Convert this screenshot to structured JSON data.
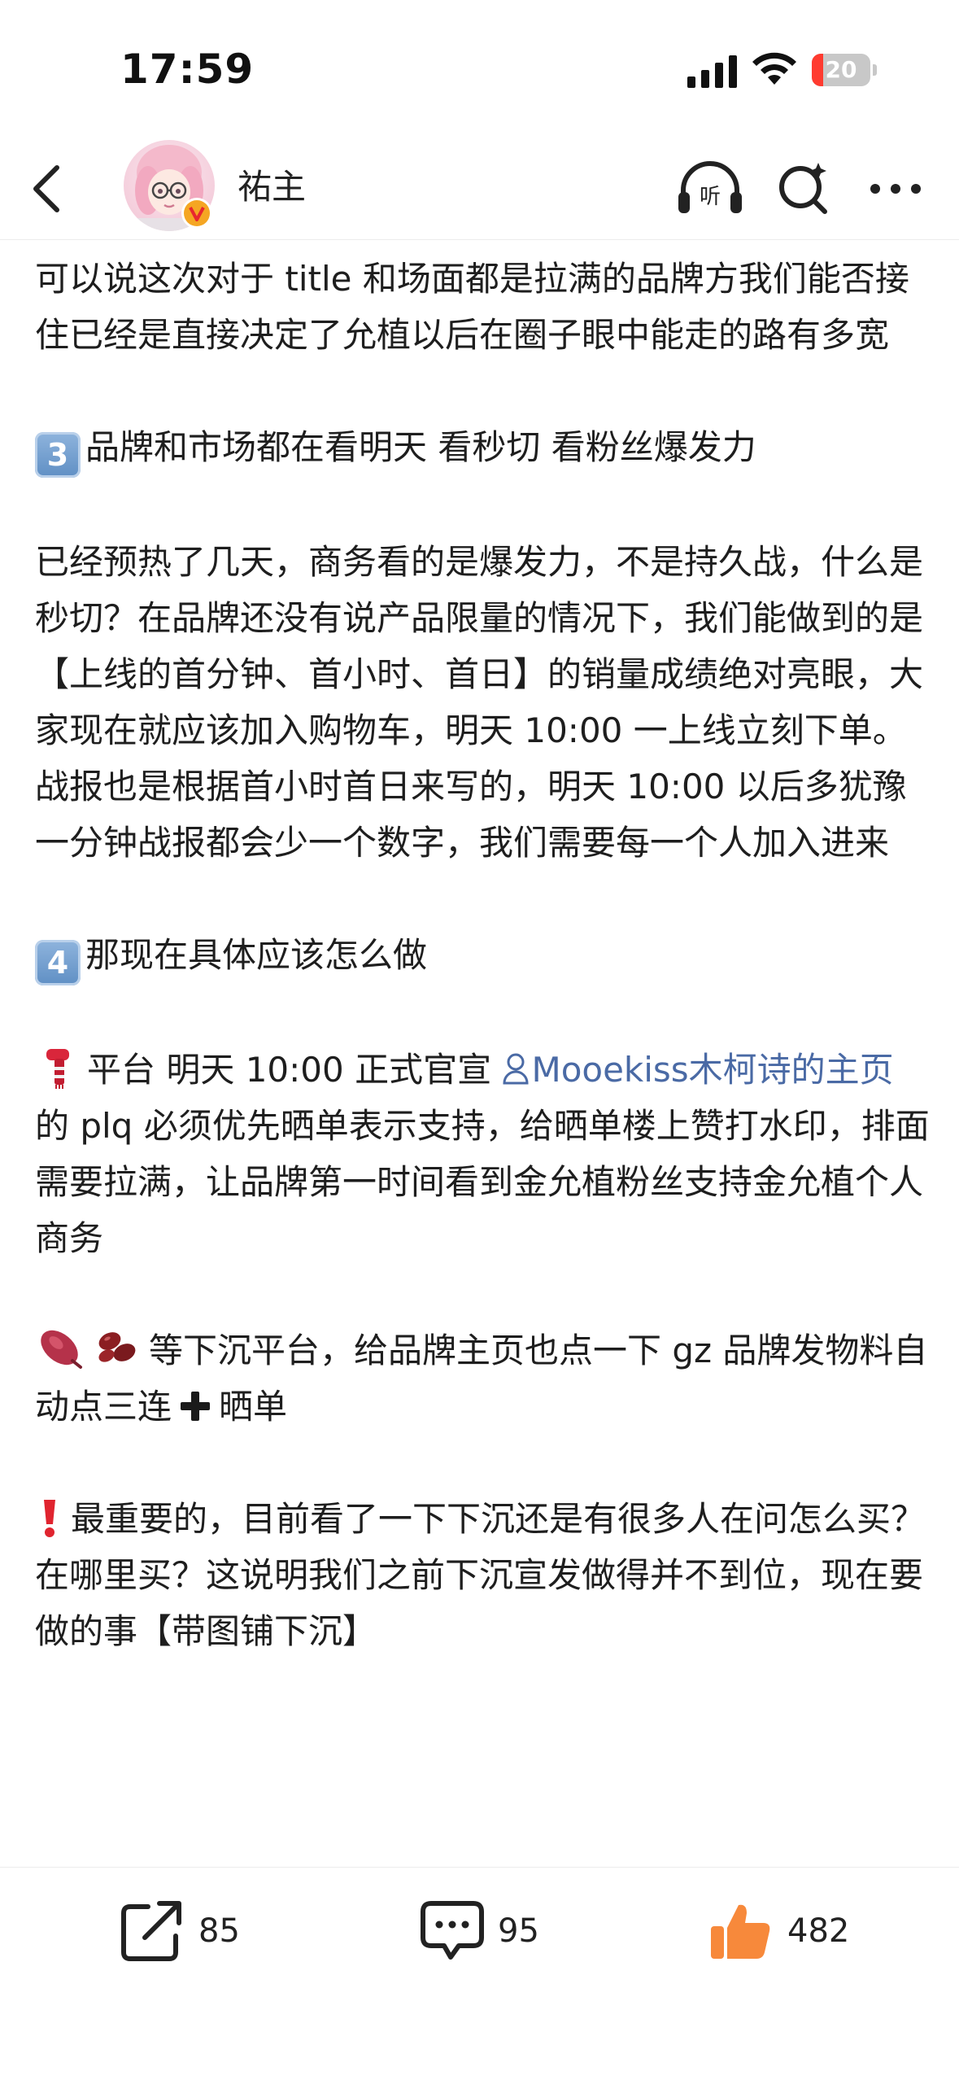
{
  "status_bar": {
    "time": "17:59",
    "battery_level": "20",
    "battery_fraction": 0.2
  },
  "header": {
    "username": "祐主",
    "listen_label": "听"
  },
  "post": {
    "p1": "可以说这次对于 title 和场面都是拉满的品牌方我们能否接住已经是直接决定了允植以后在圈子眼中能走的路有多宽",
    "s3_number": "3",
    "s3_title": "品牌和市场都在看明天 看秒切 看粉丝爆发力",
    "p3": "已经预热了几天，商务看的是爆发力，不是持久战，什么是秒切？在品牌还没有说产品限量的情况下，我们能做到的是【上线的首分钟、首小时、首日】的销量成绩绝对亮眼，大家现在就应该加入购物车，明天 10:00 一上线立刻下单。战报也是根据首小时首日来写的，明天 10:00 以后多犹豫一分钟战报都会少一个数字，我们需要每一个人加入进来",
    "s4_number": "4",
    "s4_title": "那现在具体应该怎么做",
    "p4_before": "平台 明天 10:00 正式官宣 ",
    "p4_mention": "Mooekiss木柯诗的主页",
    "p4_after": " 的 plq 必须优先晒单表示支持，给晒单楼上赞打水印，排面需要拉满，让品牌第一时间看到金允植粉丝支持金允植个人商务",
    "p5_before": "等下沉平台，给品牌主页也点一下 gz 品牌发物料自动点三连",
    "p5_after": "晒单",
    "p6": "最重要的，目前看了一下下沉还是有很多人在问怎么买？在哪里买？这说明我们之前下沉宣发做得并不到位，现在要做的事【带图铺下沉】"
  },
  "actions": {
    "share_count": "85",
    "comment_count": "95",
    "like_count": "482"
  },
  "colors": {
    "link": "#4a6aa5",
    "like_orange": "#f7893b",
    "battery_red": "#ff3b30",
    "verified_orange": "#f5a623"
  }
}
